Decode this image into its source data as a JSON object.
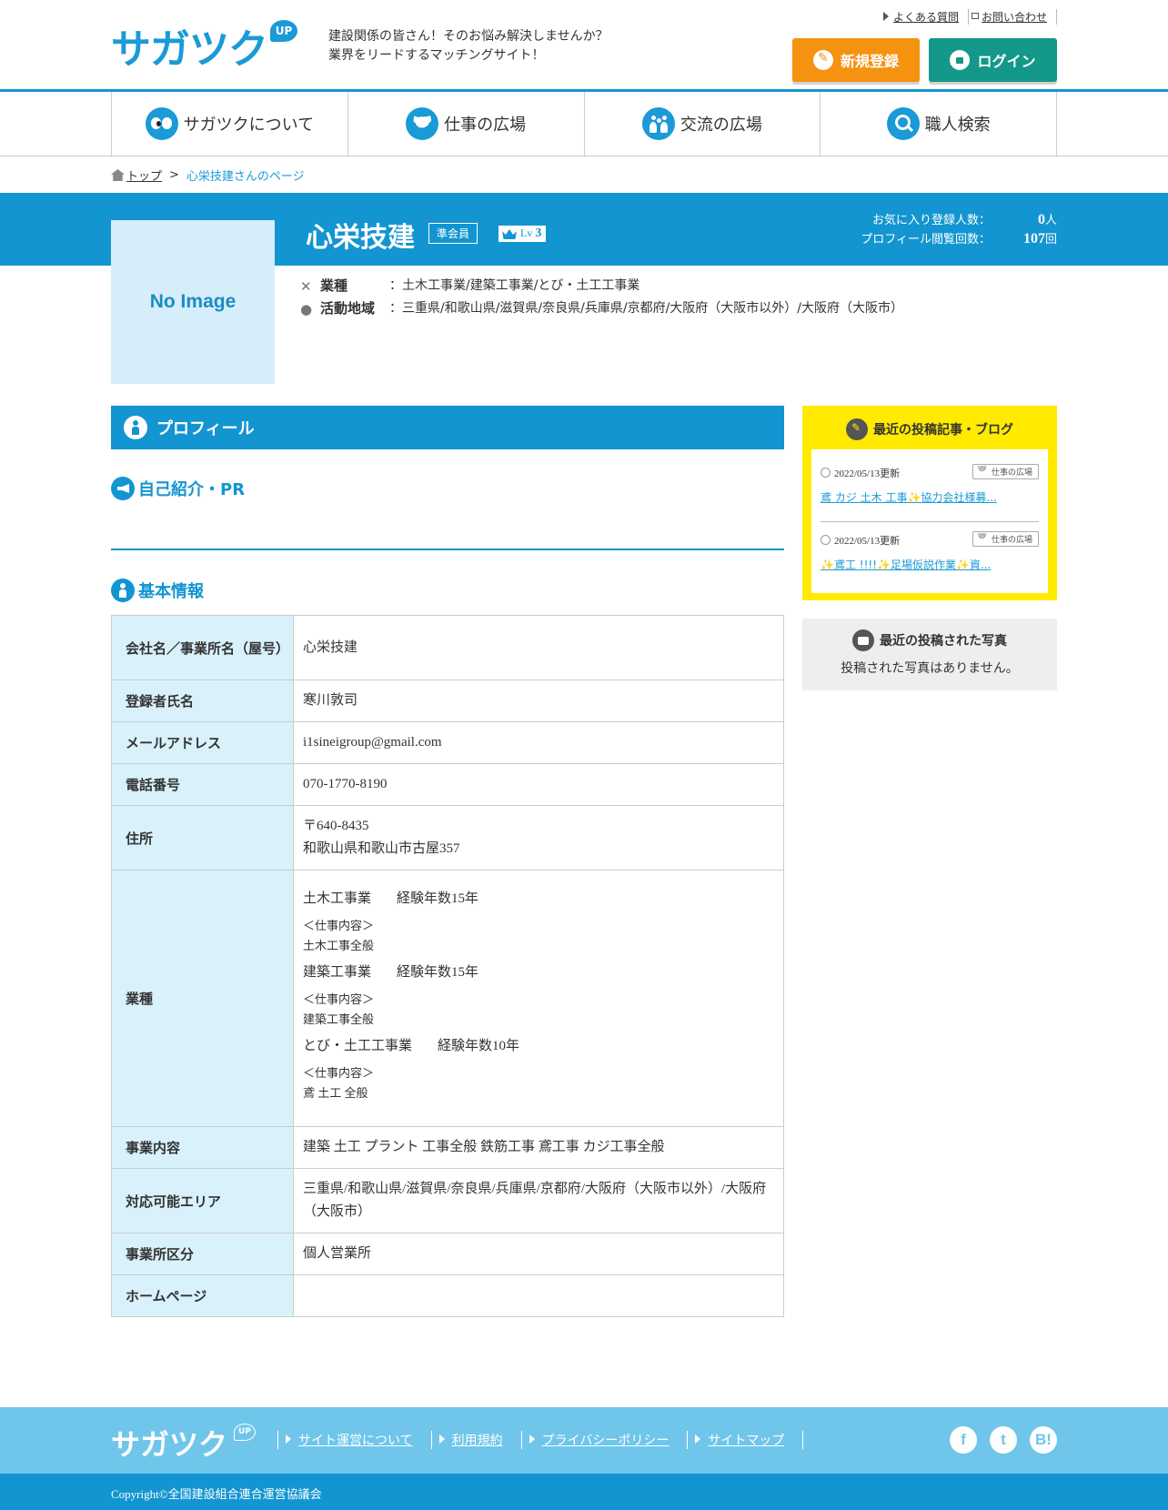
{
  "header": {
    "logo": "サガツク",
    "logo_badge": "UP",
    "tagline_1": "建設関係の皆さん！そのお悩み解決しませんか？",
    "tagline_2": "業界をリードするマッチングサイト！",
    "faq_link": "よくある質問",
    "contact_link": "お問い合わせ",
    "register_button": "新規登録",
    "login_button": "ログイン"
  },
  "nav": [
    {
      "label": "サガツクについて",
      "icon": "eyes-icon"
    },
    {
      "label": "仕事の広場",
      "icon": "handshake-icon"
    },
    {
      "label": "交流の広場",
      "icon": "people-icon"
    },
    {
      "label": "職人検索",
      "icon": "search-icon"
    }
  ],
  "breadcrumb": {
    "home": "トップ",
    "separator": ">",
    "current": "心栄技建さんのページ"
  },
  "profile": {
    "no_image": "No Image",
    "name": "心栄技建",
    "member_type": "準会員",
    "level_prefix": "Lv",
    "level": "3",
    "favorites_label": "お気に入り登録人数：",
    "favorites_count": "0",
    "favorites_unit": "人",
    "views_label": "プロフィール閲覧回数：",
    "views_count": "107",
    "views_unit": "回",
    "industry_label": "業種",
    "industry_value": "：土木工事業/建築工事業/とび・土工工事業",
    "area_label": "活動地域",
    "area_value": "：三重県/和歌山県/滋賀県/奈良県/兵庫県/京都府/大阪府（大阪市以外）/大阪府（大阪市）"
  },
  "main": {
    "section_title": "プロフィール",
    "pr_title": "自己紹介・PR",
    "basic_title": "基本情報",
    "rows": {
      "company_label": "会社名／事業所名（屋号）",
      "company_value": "心栄技建",
      "registrant_label": "登録者氏名",
      "registrant_value": "寒川敦司",
      "email_label": "メールアドレス",
      "email_value": "i1sineigroup@gmail.com",
      "phone_label": "電話番号",
      "phone_value": "070-1770-8190",
      "address_label": "住所",
      "postal_value": "〒640-8435",
      "address_value": "和歌山県和歌山市古屋357",
      "industry_label": "業種",
      "jobs": [
        {
          "name": "土木工事業",
          "years": "経験年数15年",
          "content_label": "＜仕事内容＞",
          "content": "土木工事全般"
        },
        {
          "name": "建築工事業",
          "years": "経験年数15年",
          "content_label": "＜仕事内容＞",
          "content": "建築工事全般"
        },
        {
          "name": "とび・土工工事業",
          "years": "経験年数10年",
          "content_label": "＜仕事内容＞",
          "content": "鳶 土工 全般"
        }
      ],
      "business_label": "事業内容",
      "business_value": "建築 土工 プラント 工事全般 鉄筋工事 鳶工事 カジ工事全般",
      "area_label": "対応可能エリア",
      "area_value": "三重県/和歌山県/滋賀県/奈良県/兵庫県/京都府/大阪府（大阪市以外）/大阪府（大阪市）",
      "office_type_label": "事業所区分",
      "office_type_value": "個人営業所",
      "homepage_label": "ホームページ",
      "homepage_value": ""
    }
  },
  "sidebar": {
    "blog_title": "最近の投稿記事・ブログ",
    "posts": [
      {
        "date": "2022/05/13更新",
        "tag": "仕事の広場",
        "title": "鳶 カジ 土木 工事✨協力会社様募..."
      },
      {
        "date": "2022/05/13更新",
        "tag": "仕事の広場",
        "title": "✨鳶工 !!!!✨足場仮説作業✨資..."
      }
    ],
    "photos_title": "最近の投稿された写真",
    "photos_empty": "投稿された写真はありません。"
  },
  "footer": {
    "logo": "サガツク",
    "logo_badge": "UP",
    "links": [
      "サイト運営について",
      "利用規約",
      "プライバシーポリシー",
      "サイトマップ"
    ],
    "social": [
      "f",
      "t",
      "B!"
    ],
    "copyright": "Copyright©全国建設組合連合運営協議会"
  },
  "colors": {
    "primary": "#1395d1",
    "light_primary": "#6fc6ea",
    "table_header_bg": "#d9f1fb",
    "register": "#f5920f",
    "login": "#149889",
    "blog_box": "#ffea00"
  }
}
